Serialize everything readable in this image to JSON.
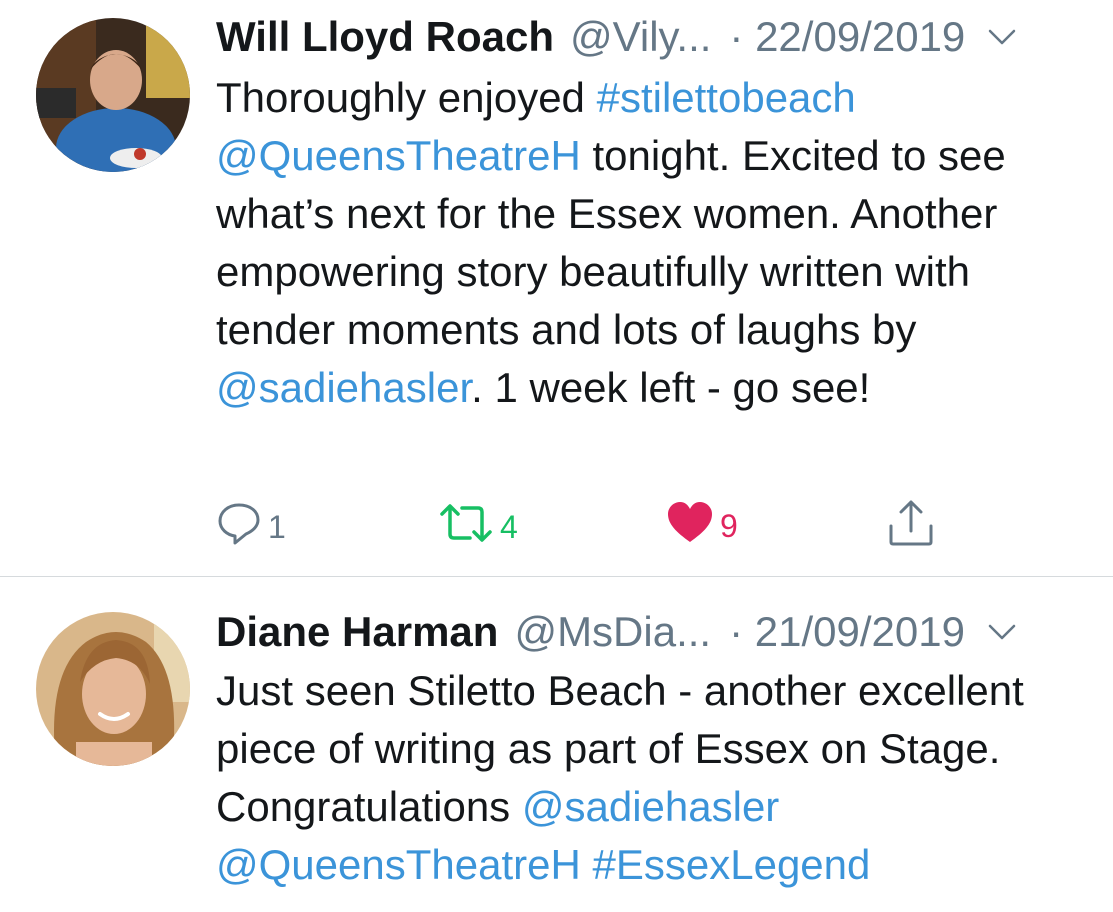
{
  "tweets": [
    {
      "author_name": "Will Lloyd Roach",
      "handle": "@Vily...",
      "date": "· 22/09/2019",
      "text_parts": [
        {
          "t": "Thoroughly enjoyed "
        },
        {
          "t": "#stilettobeach"
        },
        {
          "t": " "
        },
        {
          "t": "@QueensTheatreH"
        },
        {
          "t": " tonight. Excited to see what’s next for the Essex women. Another empowering story beautifully written with tender moments and lots of laughs by "
        },
        {
          "t": "@sadiehasler"
        },
        {
          "t": ". 1 week left - go see!"
        }
      ],
      "actions": {
        "reply_count": "1",
        "retweet_count": "4",
        "like_count": "9"
      }
    },
    {
      "author_name": "Diane Harman",
      "handle": "@MsDia...",
      "date": "· 21/09/2019",
      "text_parts": [
        {
          "t": "Just seen Stiletto Beach - another excellent piece of writing as part of Essex on Stage. Congratulations "
        },
        {
          "t": "@sadiehasler"
        },
        {
          "t": " "
        },
        {
          "t": "@QueensTheatreH"
        },
        {
          "t": " "
        },
        {
          "t": "#EssexLegend"
        }
      ]
    }
  ],
  "colors": {
    "link": "#3b94d9",
    "secondary_text": "#657786",
    "retweet": "#17bf63",
    "like": "#e0245e",
    "divider": "#d6dadd"
  },
  "icons": {
    "reply": "reply-icon",
    "retweet": "retweet-icon",
    "like": "heart-icon",
    "share": "share-icon",
    "menu": "chevron-down-icon"
  }
}
